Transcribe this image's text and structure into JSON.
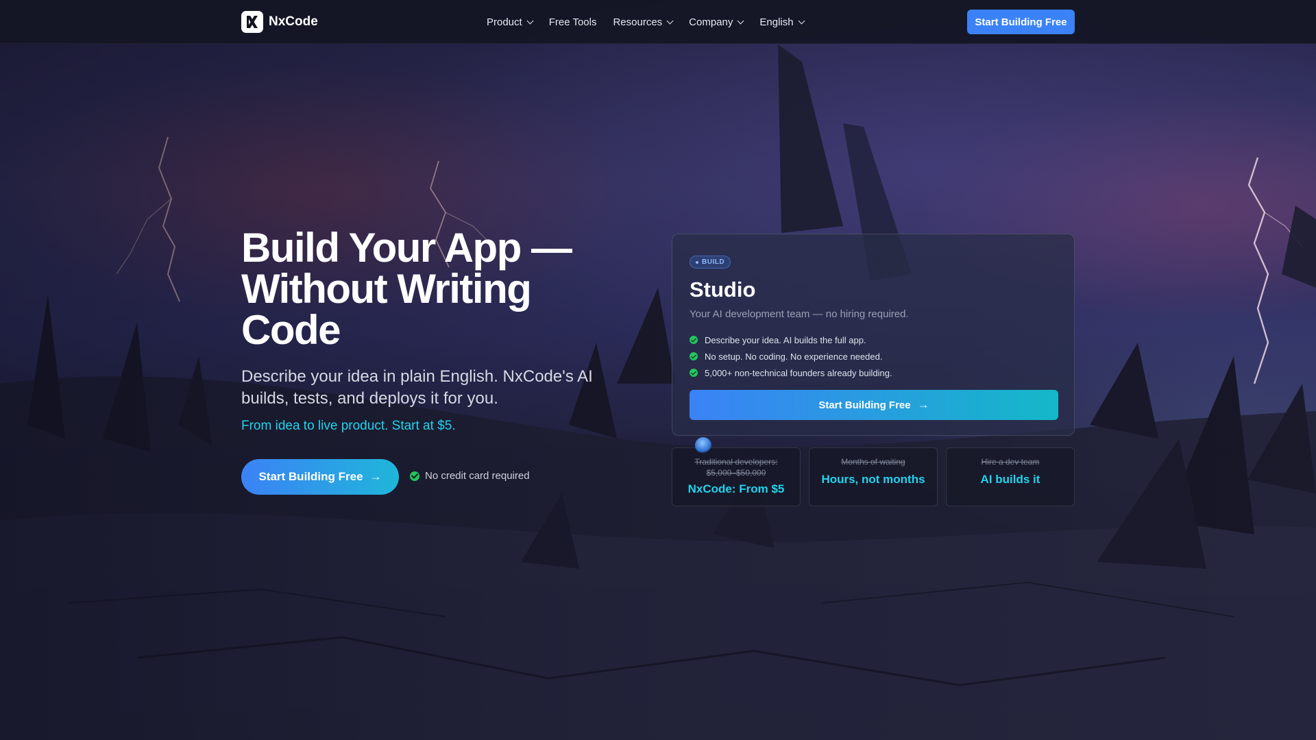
{
  "nav": {
    "logo_text": "NxCode",
    "menu": [
      {
        "label": "Product",
        "dropdown": true
      },
      {
        "label": "Free Tools",
        "dropdown": false
      },
      {
        "label": "Resources",
        "dropdown": true
      },
      {
        "label": "Company",
        "dropdown": true
      },
      {
        "label": "English",
        "dropdown": true
      }
    ],
    "cta_label": "Start Building Free"
  },
  "hero": {
    "title_line1": "Build Your App —",
    "title_line2": "Without Writing",
    "title_line3": "Code",
    "subtitle": "Describe your idea in plain English. NxCode's AI builds, tests, and deploys it for you.",
    "accent": "From idea to live product. Start at $5.",
    "cta_label": "Start Building Free",
    "cta_arrow": "→",
    "no_cc": "No credit card required"
  },
  "card": {
    "badge": "BUILD",
    "title": "Studio",
    "subtitle": "Your AI development team — no hiring required.",
    "features": [
      "Describe your idea. AI builds the full app.",
      "No setup. No coding. No experience needed.",
      "5,000+ non-technical founders already building."
    ],
    "cta_label": "Start Building Free",
    "cta_arrow": "→"
  },
  "comparisons": [
    {
      "strike_line1": "Traditional developers:",
      "strike_line2": "$5,000–$50,000",
      "value": "NxCode: From $5"
    },
    {
      "strike_line1": "Months of waiting",
      "strike_line2": "",
      "value": "Hours, not months"
    },
    {
      "strike_line1": "Hire a dev team",
      "strike_line2": "",
      "value": "AI builds it"
    }
  ],
  "colors": {
    "accent_blue": "#3b82f6",
    "accent_cyan": "#22d3ee",
    "check_green": "#22c55e"
  }
}
